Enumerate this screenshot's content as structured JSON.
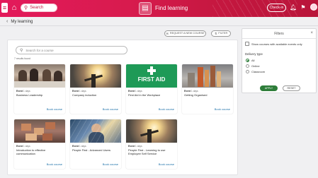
{
  "header": {
    "menu_icon": "hamburger-icon",
    "search_label": "Search",
    "title": "Find learning",
    "checkin_label": "Check-in",
    "colors": {
      "primary": "#d81b4e",
      "accent_green": "#2e7d3a",
      "link": "#1a6fa8"
    }
  },
  "breadcrumb": {
    "label": "My learning"
  },
  "toolbar": {
    "request_label": "REQUEST A NEW COURSE",
    "filter_label": "FILTER"
  },
  "main": {
    "search_placeholder": "Search for a course",
    "count": "7 results found"
  },
  "courses": [
    {
      "type": "Event",
      "duration": "1 days",
      "title": "Business Leadership",
      "book": "Book course"
    },
    {
      "type": "Event",
      "duration": "1 days",
      "title": "Company induction",
      "book": "Book course"
    },
    {
      "type": "Event",
      "duration": "1 days",
      "title": "First Aid in the Workplace",
      "book": "Book course",
      "image_text": "FIRST AID"
    },
    {
      "type": "Event",
      "duration": "1 days",
      "title": "Getting Organised",
      "book": "Book course"
    },
    {
      "type": "Event",
      "duration": "1 days",
      "title": "Introduction to effective communication",
      "book": "Book course"
    },
    {
      "type": "Event",
      "duration": "1 days",
      "title": "People First - Advanced Users",
      "book": "Book course"
    },
    {
      "type": "Event",
      "duration": "1 days",
      "title": "People First - Learning to use Employee Self Service",
      "book": "Book course"
    }
  ],
  "filters": {
    "title": "Filters",
    "only_available": "Show courses with available events only",
    "delivery_type_label": "Delivery type",
    "options": [
      "All",
      "Online",
      "Classroom"
    ],
    "selected": "All",
    "apply_label": "APPLY",
    "reset_label": "RESET"
  }
}
